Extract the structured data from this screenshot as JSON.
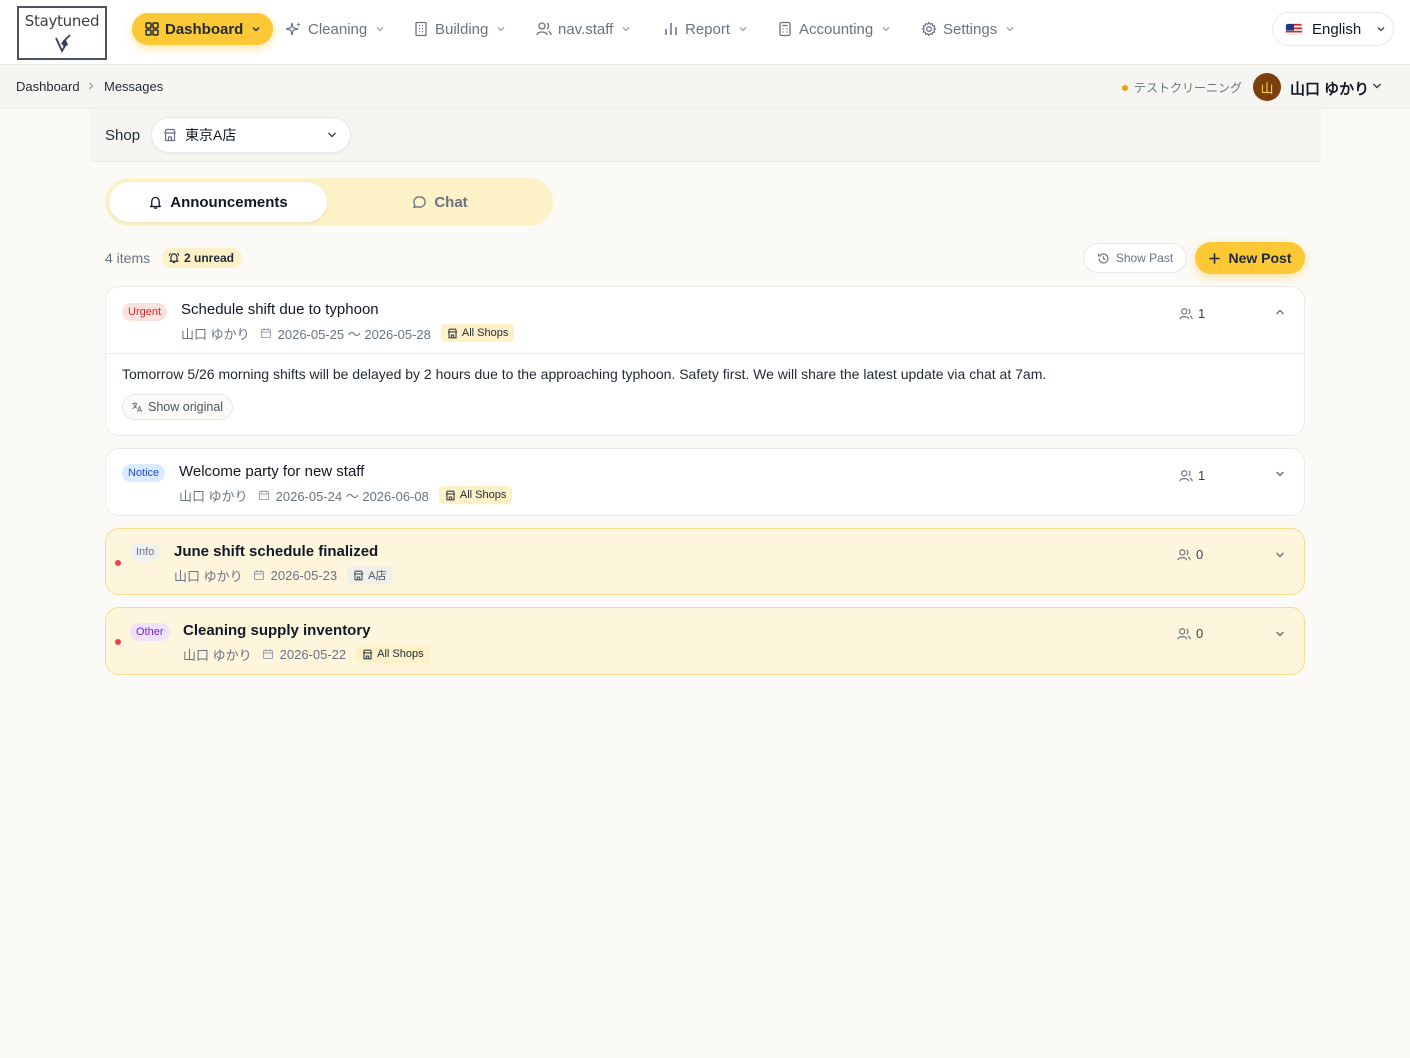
{
  "brand": {
    "logo_text": "Staytuned"
  },
  "nav": {
    "items": [
      {
        "label": "Dashboard",
        "icon": "dashboard-grid-icon"
      },
      {
        "label": "Cleaning",
        "icon": "sparkles-icon"
      },
      {
        "label": "Building",
        "icon": "building-icon"
      },
      {
        "label": "nav.staff",
        "icon": "users-icon"
      },
      {
        "label": "Report",
        "icon": "bar-chart-icon"
      },
      {
        "label": "Accounting",
        "icon": "calculator-icon"
      },
      {
        "label": "Settings",
        "icon": "gear-icon"
      }
    ],
    "active": "Dashboard",
    "language": "English"
  },
  "breadcrumb": {
    "items": [
      "Dashboard",
      "Messages"
    ]
  },
  "org": {
    "name": "テストクリーニング"
  },
  "user": {
    "name": "山口 ゆかり",
    "avatar_initial": "山"
  },
  "shop": {
    "label": "Shop",
    "selected": "東京A店"
  },
  "tabs": {
    "announcements": "Announcements",
    "chat": "Chat",
    "active": "Announcements"
  },
  "toolbar": {
    "count": "4 items",
    "unread": "2 unread",
    "show_past": "Show Past",
    "new_post": "New Post"
  },
  "colors": {
    "accent": "#fcc835",
    "unread_bg": "#fdf6dd",
    "urgent": "#dc2626",
    "notice": "#1d4ed8",
    "other": "#7e22ce"
  },
  "posts": [
    {
      "category": "Urgent",
      "title": "Schedule shift due to typhoon",
      "author": "山口 ゆかり",
      "dates": "2026-05-25 〜 2026-05-28",
      "shop": "All Shops",
      "readers": "1",
      "unread": false,
      "expanded": true,
      "body": "Tomorrow 5/26 morning shifts will be delayed by 2 hours due to the approaching typhoon. Safety first. We will share the latest update via chat at 7am.",
      "show_original": "Show original"
    },
    {
      "category": "Notice",
      "title": "Welcome party for new staff",
      "author": "山口 ゆかり",
      "dates": "2026-05-24 〜 2026-06-08",
      "shop": "All Shops",
      "readers": "1",
      "unread": false,
      "expanded": false
    },
    {
      "category": "Info",
      "title": "June shift schedule finalized",
      "author": "山口 ゆかり",
      "dates": "2026-05-23",
      "shop": "A店",
      "readers": "0",
      "unread": true,
      "expanded": false
    },
    {
      "category": "Other",
      "title": "Cleaning supply inventory",
      "author": "山口 ゆかり",
      "dates": "2026-05-22",
      "shop": "All Shops",
      "readers": "0",
      "unread": true,
      "expanded": false
    }
  ]
}
